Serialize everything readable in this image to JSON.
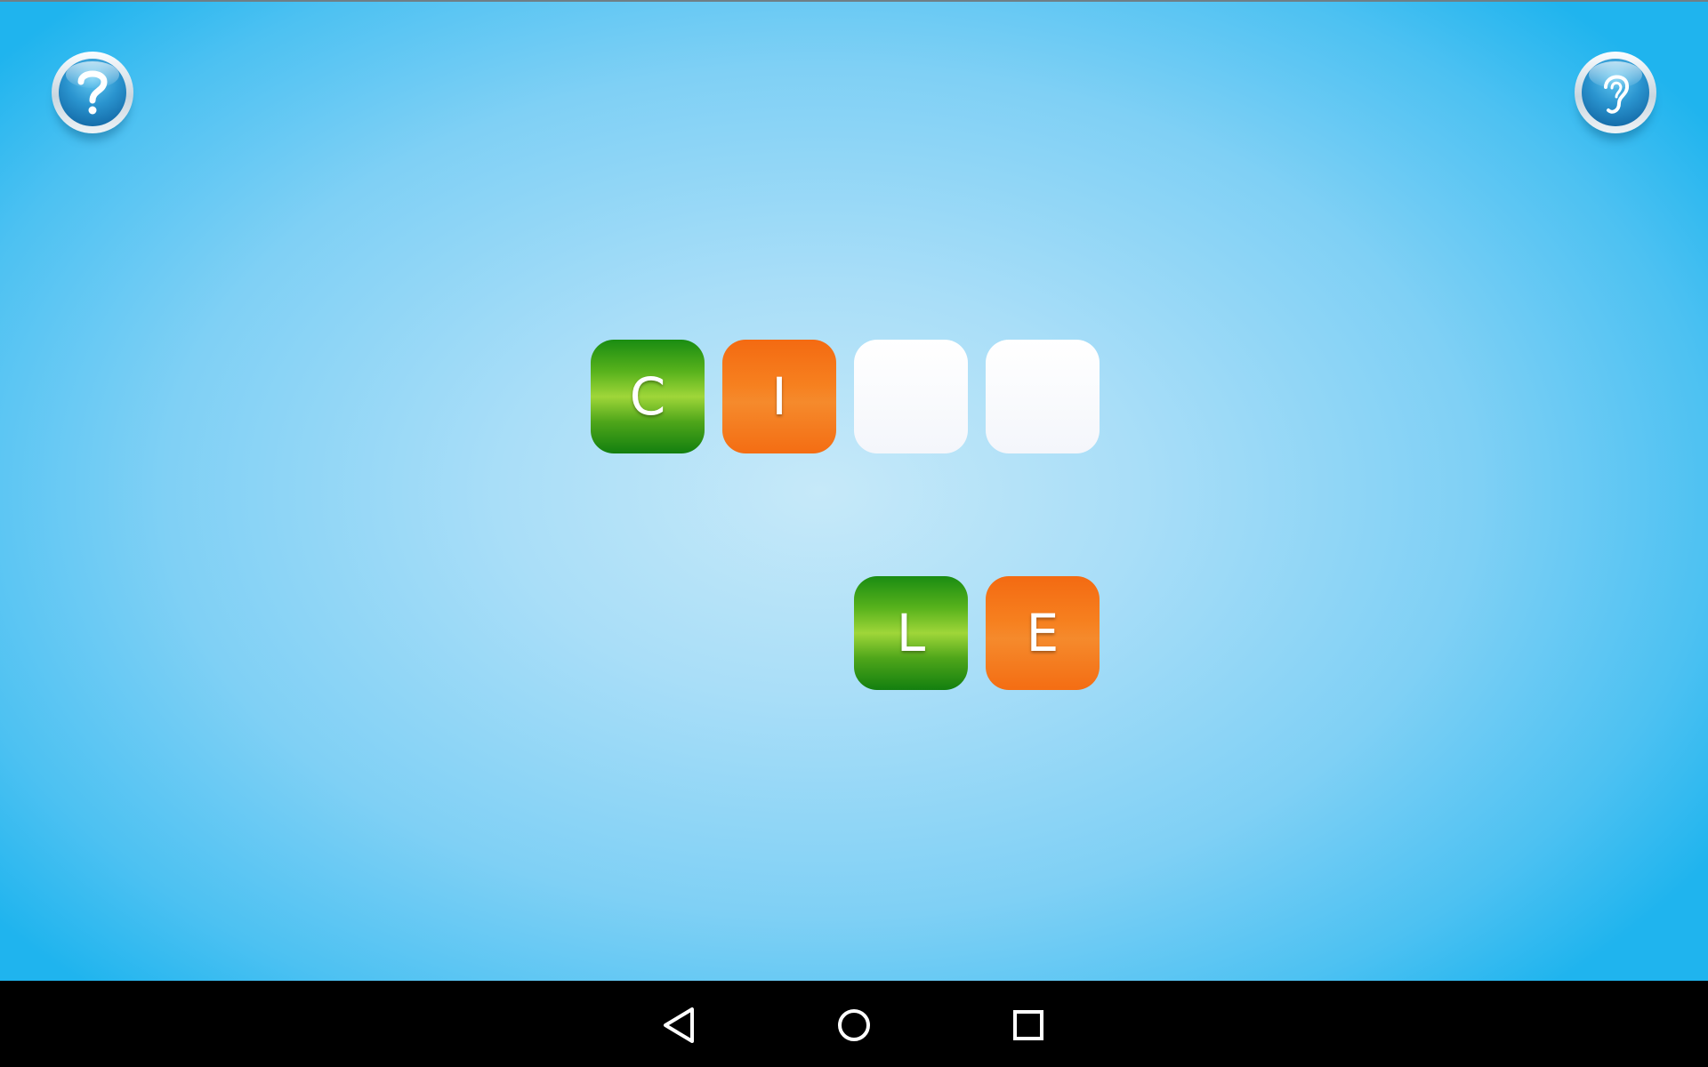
{
  "toolbar": {
    "help_icon": "question-mark-icon",
    "listen_icon": "ear-icon"
  },
  "answer_slots": [
    {
      "letter": "C",
      "color": "green"
    },
    {
      "letter": "I",
      "color": "orange"
    },
    {
      "letter": "",
      "color": "empty"
    },
    {
      "letter": "",
      "color": "empty"
    }
  ],
  "letter_choices": [
    {
      "letter": "L",
      "color": "green"
    },
    {
      "letter": "E",
      "color": "orange"
    }
  ],
  "colors": {
    "tile_green": "#3a9c17",
    "tile_orange": "#f47a1c",
    "tile_empty": "#fafbfd",
    "background_center": "#c6e9f9",
    "background_edge": "#1fb4ee",
    "navbar": "#000000"
  },
  "navigation_bar": {
    "icons": [
      "back-icon",
      "home-icon",
      "recents-icon"
    ]
  }
}
